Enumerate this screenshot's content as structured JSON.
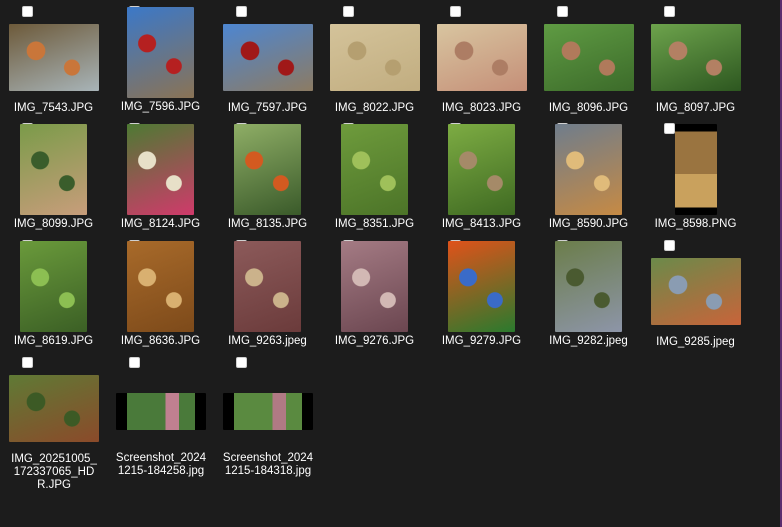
{
  "files": [
    {
      "name": "IMG_7543.JPG",
      "orientation": "landscape",
      "icon": "tree-fruit-photo",
      "colors": [
        "#6d5a3a",
        "#a8b4b8",
        "#c9763a"
      ]
    },
    {
      "name": "IMG_7596.JPG",
      "orientation": "portrait-tall",
      "icon": "tractor-field-photo",
      "colors": [
        "#3b78c8",
        "#8a7355",
        "#b52020"
      ]
    },
    {
      "name": "IMG_7597.JPG",
      "orientation": "landscape",
      "icon": "tractor-field-photo",
      "colors": [
        "#4d86d1",
        "#8c7b63",
        "#a01818"
      ]
    },
    {
      "name": "IMG_8022.JPG",
      "orientation": "landscape",
      "icon": "grain-photo",
      "colors": [
        "#d4c39a",
        "#c1ad80",
        "#b59f70"
      ]
    },
    {
      "name": "IMG_8023.JPG",
      "orientation": "landscape",
      "icon": "grain-hand-photo",
      "colors": [
        "#d8c5a0",
        "#c58f78",
        "#ad7d64"
      ]
    },
    {
      "name": "IMG_8096.JPG",
      "orientation": "landscape",
      "icon": "greens-photo",
      "colors": [
        "#5f9b43",
        "#3c6b2a",
        "#b07a5b"
      ]
    },
    {
      "name": "IMG_8097.JPG",
      "orientation": "landscape",
      "icon": "greens-photo",
      "colors": [
        "#6da34c",
        "#2d5720",
        "#b38063"
      ]
    },
    {
      "name": "IMG_8099.JPG",
      "orientation": "portrait",
      "icon": "roots-photo",
      "colors": [
        "#7a9b49",
        "#c89d7b",
        "#3a5d2b"
      ]
    },
    {
      "name": "IMG_8124.JPG",
      "orientation": "portrait",
      "icon": "radish-photo",
      "colors": [
        "#4d7a33",
        "#d03a6b",
        "#e7e0c8"
      ]
    },
    {
      "name": "IMG_8135.JPG",
      "orientation": "portrait",
      "icon": "persimmon-tree-photo",
      "colors": [
        "#8fae66",
        "#3a5a2a",
        "#d35a20"
      ]
    },
    {
      "name": "IMG_8351.JPG",
      "orientation": "portrait",
      "icon": "peas-photo",
      "colors": [
        "#6e9b3c",
        "#4c7428",
        "#9fc05a"
      ]
    },
    {
      "name": "IMG_8413.JPG",
      "orientation": "portrait",
      "icon": "peas-box-photo",
      "colors": [
        "#7dac43",
        "#3f6a22",
        "#a58a68"
      ]
    },
    {
      "name": "IMG_8590.JPG",
      "orientation": "portrait",
      "icon": "fruit-cloth-photo",
      "colors": [
        "#6f7d8c",
        "#c68a44",
        "#e0bb7a"
      ]
    },
    {
      "name": "IMG_8598.PNG",
      "orientation": "portrait-narrow",
      "icon": "potatoes-photo",
      "colors": [
        "#000000",
        "#9a7440",
        "#c9a15d"
      ]
    },
    {
      "name": "IMG_8619.JPG",
      "orientation": "portrait",
      "icon": "beans-photo",
      "colors": [
        "#6a9a3b",
        "#3b5f25",
        "#8cbf52"
      ]
    },
    {
      "name": "IMG_8636.JPG",
      "orientation": "portrait",
      "icon": "nuts-photo",
      "colors": [
        "#a86a2a",
        "#7d4a1a",
        "#d9b070"
      ]
    },
    {
      "name": "IMG_9263.jpeg",
      "orientation": "portrait",
      "icon": "sweet-potato-photo",
      "colors": [
        "#8c5a5a",
        "#6b3b3b",
        "#cbb28b"
      ]
    },
    {
      "name": "IMG_9276.JPG",
      "orientation": "portrait",
      "icon": "sweet-potato-photo",
      "colors": [
        "#a47b84",
        "#6b4650",
        "#d2b8b4"
      ]
    },
    {
      "name": "IMG_9279.JPG",
      "orientation": "portrait",
      "icon": "tomatoes-photo",
      "colors": [
        "#e0521a",
        "#2a7a2e",
        "#3a6bc8"
      ]
    },
    {
      "name": "IMG_9282.jpeg",
      "orientation": "portrait",
      "icon": "garden-photo",
      "colors": [
        "#6b7d4a",
        "#8d95a8",
        "#4a5a30"
      ]
    },
    {
      "name": "IMG_9285.jpeg",
      "orientation": "landscape",
      "icon": "garden-photo",
      "colors": [
        "#6b8a4a",
        "#c8643a",
        "#8a9cb2"
      ]
    },
    {
      "name": "IMG_20251005_172337065_HDR.JPG",
      "orientation": "landscape",
      "icon": "grass-photo",
      "colors": [
        "#5f7a35",
        "#8b4a2a",
        "#3c5a25"
      ]
    },
    {
      "name": "Screenshot_20241215-184258.jpg",
      "orientation": "screenshot",
      "icon": "screenshot-photo",
      "colors": [
        "#000000",
        "#4a7a3a",
        "#c08090"
      ]
    },
    {
      "name": "Screenshot_20241215-184318.jpg",
      "orientation": "screenshot",
      "icon": "screenshot-photo",
      "colors": [
        "#000000",
        "#5a8a40",
        "#b07a84"
      ]
    }
  ]
}
